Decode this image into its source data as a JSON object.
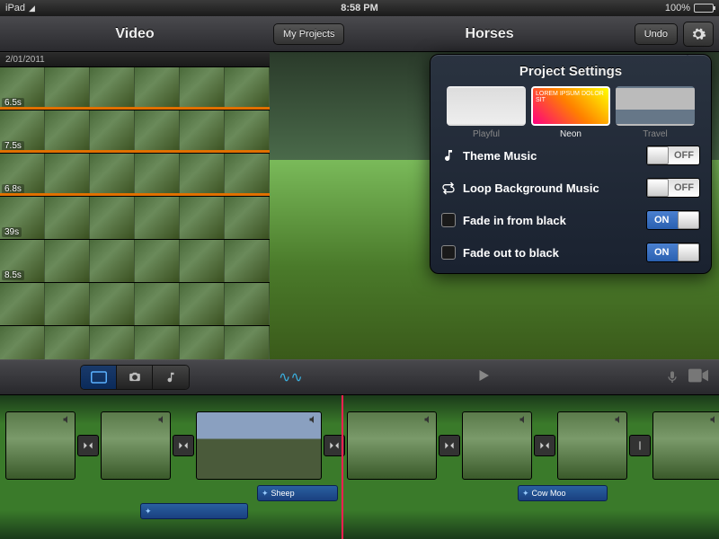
{
  "status": {
    "device": "iPad",
    "time": "8:58 PM",
    "battery": "100%"
  },
  "header": {
    "video_label": "Video",
    "my_projects": "My Projects",
    "title": "Horses",
    "undo": "Undo"
  },
  "clips": {
    "date": "2/01/2011",
    "items": [
      {
        "duration": "6.5s"
      },
      {
        "duration": "7.5s"
      },
      {
        "duration": "6.8s"
      },
      {
        "duration": "39s"
      },
      {
        "duration": "8.5s"
      }
    ]
  },
  "popover": {
    "title": "Project Settings",
    "themes": [
      {
        "name": "Playful",
        "selected": false
      },
      {
        "name": "Neon",
        "selected": true,
        "text": "LOREM IPSUM DOLOR SIT"
      },
      {
        "name": "Travel",
        "selected": false
      }
    ],
    "rows": {
      "theme_music": {
        "label": "Theme Music",
        "state": "OFF"
      },
      "loop_bg": {
        "label": "Loop Background Music",
        "state": "OFF"
      },
      "fade_in": {
        "label": "Fade in from black",
        "state": "ON"
      },
      "fade_out": {
        "label": "Fade out to black",
        "state": "ON"
      }
    }
  },
  "audio_clips": [
    {
      "label": "Sheep"
    },
    {
      "label": "Cow Moo"
    }
  ]
}
